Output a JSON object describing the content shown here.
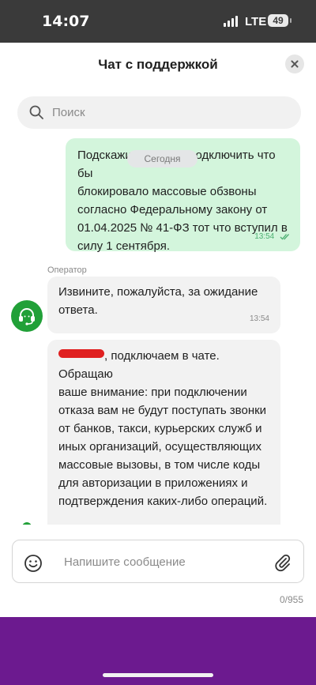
{
  "status_bar": {
    "time": "14:07",
    "network": "LTE",
    "battery": "49"
  },
  "header": {
    "title": "Чат с поддержкой"
  },
  "search": {
    "placeholder": "Поиск"
  },
  "chat": {
    "date_divider": "Сегодня",
    "messages": [
      {
        "direction": "outgoing",
        "text": "Подскажите, можно подключить что бы\nблокировало массовые обзвоны\nсогласно Федеральному закону от\n01.04.2025 № 41-ФЗ тот что вступил в\nсилу 1 сентября.",
        "time": "13:54",
        "status": "read"
      },
      {
        "direction": "incoming",
        "sender": "Оператор",
        "text": "Извините, пожалуйста, за ожидание\nответа.",
        "time": "13:54"
      },
      {
        "direction": "incoming",
        "text_after_redaction": ", подключаем в чате. Обращаю\nваше внимание: при подключении\nотказа вам не будут поступать звонки\nот банков, такси, курьерских служб и\nиных организаций, осуществляющих\nмассовые вызовы, в том числе коды\nдля авторизации в приложениях и\nподтверждения каких-либо операций.\n\nСкажите, пожалуйста, подключаем"
      }
    ]
  },
  "composer": {
    "placeholder": "Напишите сообщение",
    "counter": "0/955"
  },
  "colors": {
    "outgoing_bubble": "#d3f5dc",
    "incoming_bubble": "#f2f2f2",
    "accent_green": "#21a038",
    "bottom_bar": "#6c1a8f",
    "status_bar": "#3a3a3a"
  }
}
